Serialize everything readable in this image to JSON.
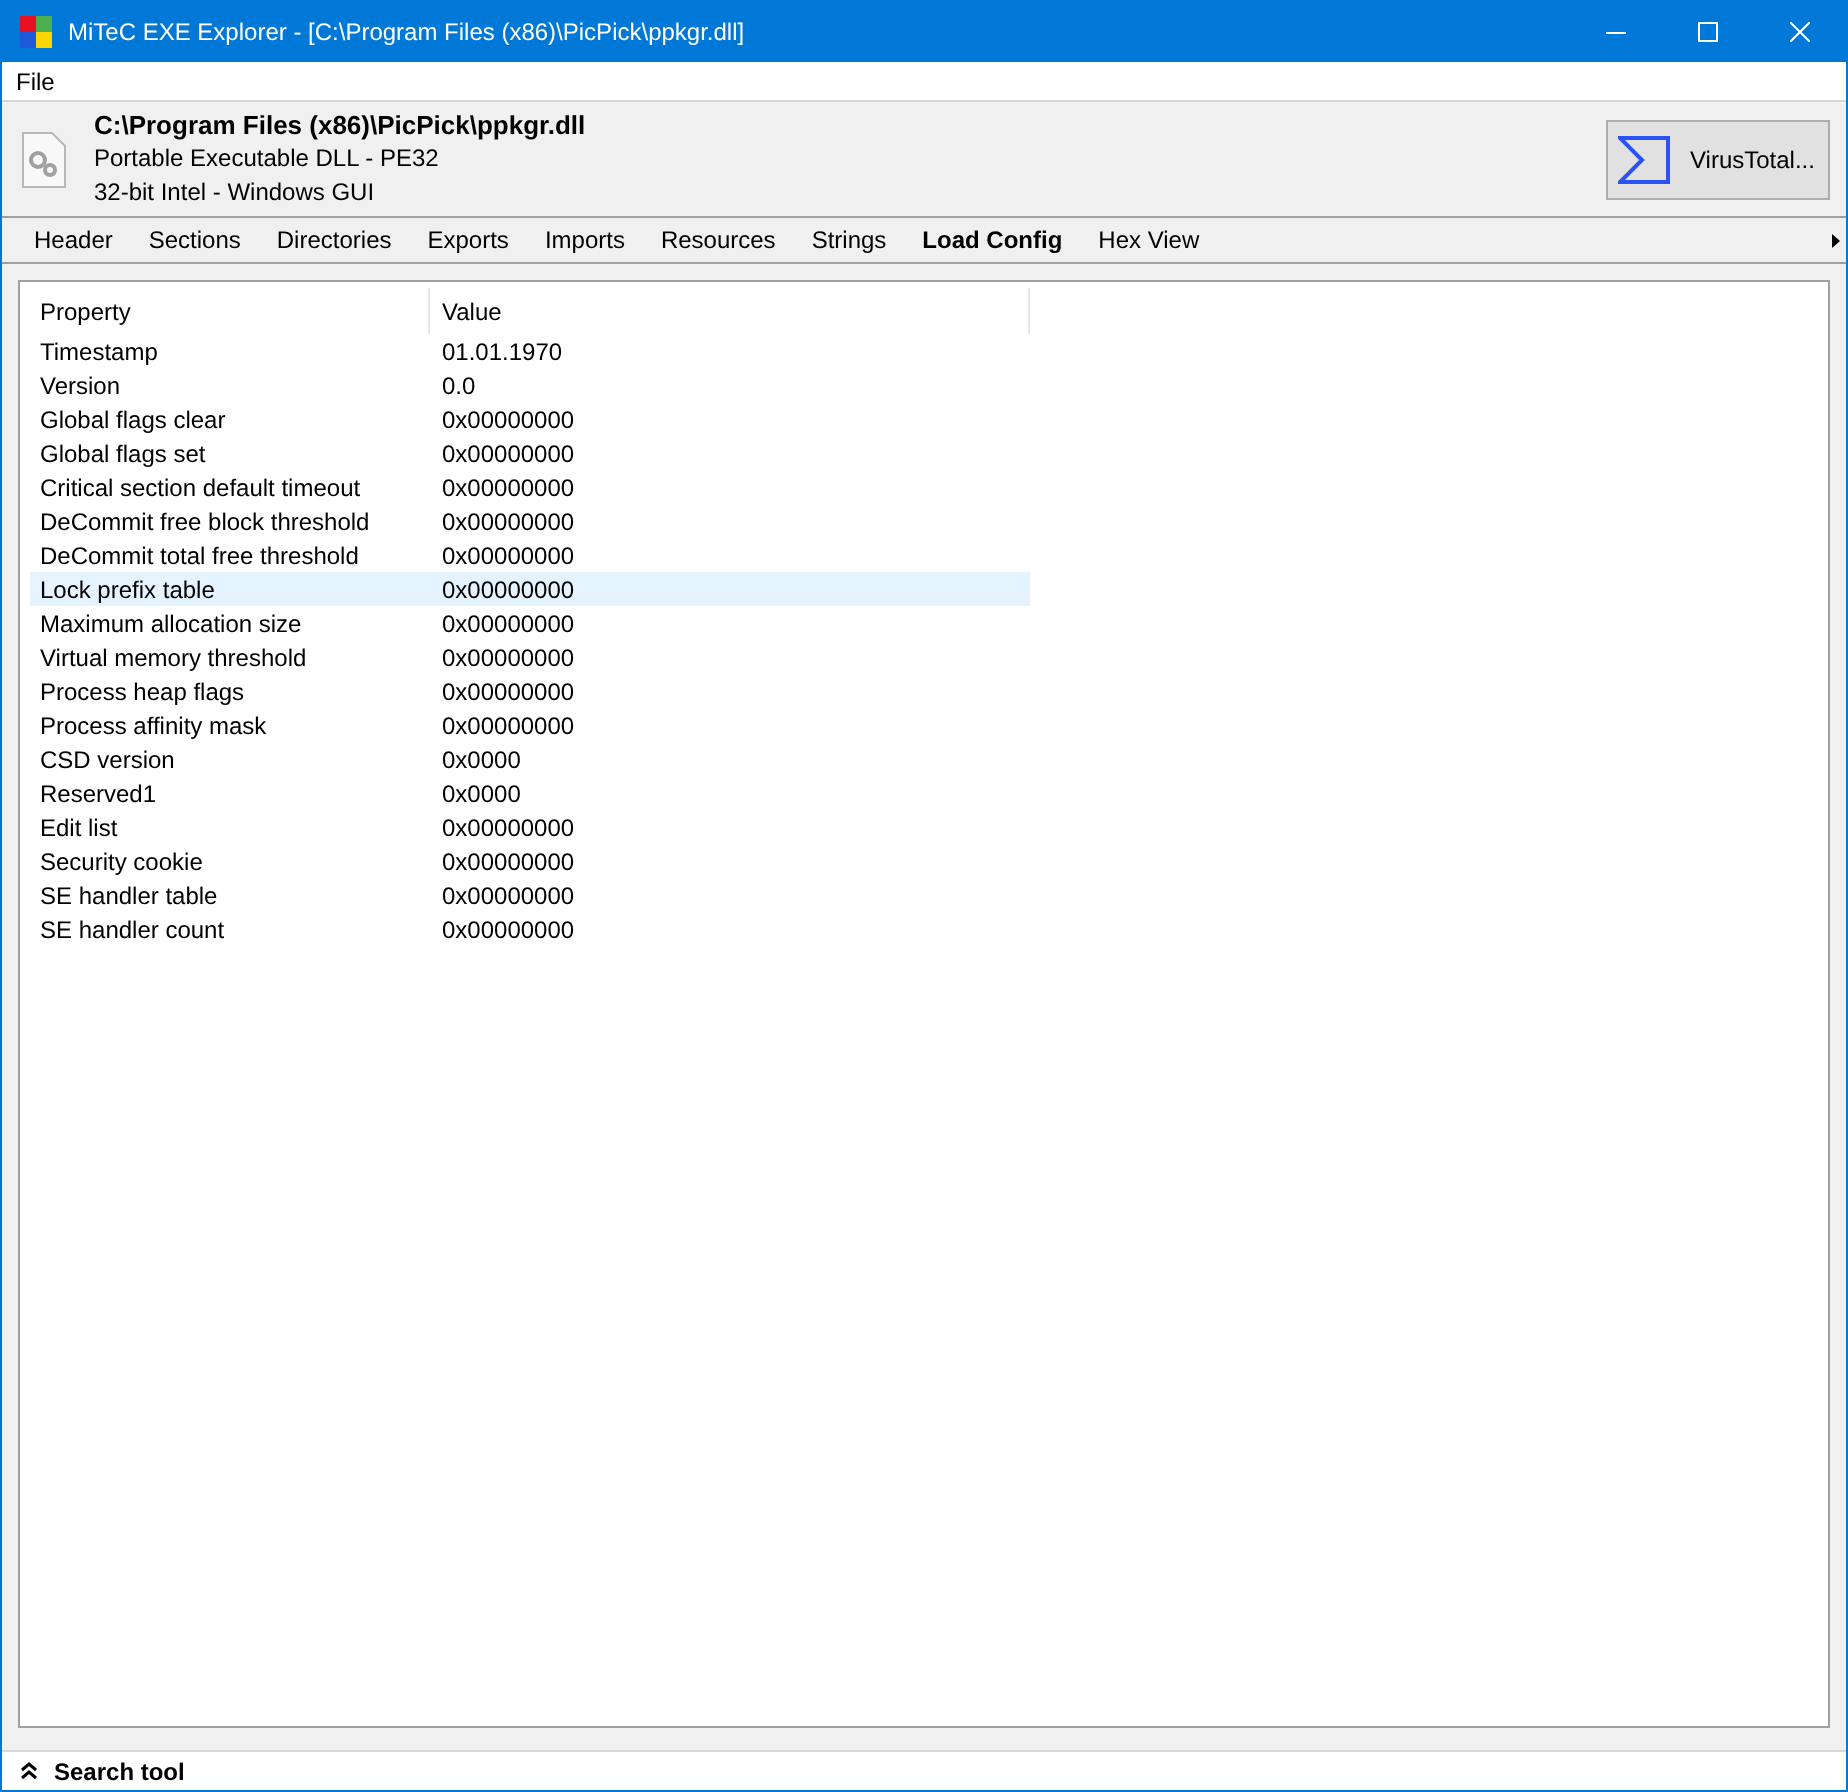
{
  "window": {
    "title": "MiTeC EXE Explorer - [C:\\Program Files (x86)\\PicPick\\ppkgr.dll]"
  },
  "menu": [
    "File"
  ],
  "file_info": {
    "path": "C:\\Program Files (x86)\\PicPick\\ppkgr.dll",
    "type": "Portable Executable DLL - PE32",
    "platform": "32-bit Intel - Windows GUI"
  },
  "virustotal_button": "VirusTotal...",
  "tabs": [
    {
      "label": "Header",
      "selected": false
    },
    {
      "label": "Sections",
      "selected": false
    },
    {
      "label": "Directories",
      "selected": false
    },
    {
      "label": "Exports",
      "selected": false
    },
    {
      "label": "Imports",
      "selected": false
    },
    {
      "label": "Resources",
      "selected": false
    },
    {
      "label": "Strings",
      "selected": false
    },
    {
      "label": "Load Config",
      "selected": true
    },
    {
      "label": "Hex View",
      "selected": false
    }
  ],
  "table": {
    "columns": [
      "Property",
      "Value"
    ],
    "rows": [
      {
        "property": "Timestamp",
        "value": "01.01.1970",
        "selected": false
      },
      {
        "property": "Version",
        "value": "0.0",
        "selected": false
      },
      {
        "property": "Global flags clear",
        "value": "0x00000000",
        "selected": false
      },
      {
        "property": "Global flags set",
        "value": "0x00000000",
        "selected": false
      },
      {
        "property": "Critical section default timeout",
        "value": "0x00000000",
        "selected": false
      },
      {
        "property": "DeCommit free block threshold",
        "value": "0x00000000",
        "selected": false
      },
      {
        "property": "DeCommit total free threshold",
        "value": "0x00000000",
        "selected": false
      },
      {
        "property": "Lock prefix table",
        "value": "0x00000000",
        "selected": true
      },
      {
        "property": "Maximum allocation size",
        "value": "0x00000000",
        "selected": false
      },
      {
        "property": "Virtual memory threshold",
        "value": "0x00000000",
        "selected": false
      },
      {
        "property": "Process heap flags",
        "value": "0x00000000",
        "selected": false
      },
      {
        "property": "Process affinity mask",
        "value": "0x00000000",
        "selected": false
      },
      {
        "property": "CSD version",
        "value": "0x0000",
        "selected": false
      },
      {
        "property": "Reserved1",
        "value": "0x0000",
        "selected": false
      },
      {
        "property": "Edit list",
        "value": "0x00000000",
        "selected": false
      },
      {
        "property": "Security cookie",
        "value": "0x00000000",
        "selected": false
      },
      {
        "property": "SE handler table",
        "value": "0x00000000",
        "selected": false
      },
      {
        "property": "SE handler count",
        "value": "0x00000000",
        "selected": false
      }
    ]
  },
  "search_tool": {
    "label": "Search tool"
  }
}
